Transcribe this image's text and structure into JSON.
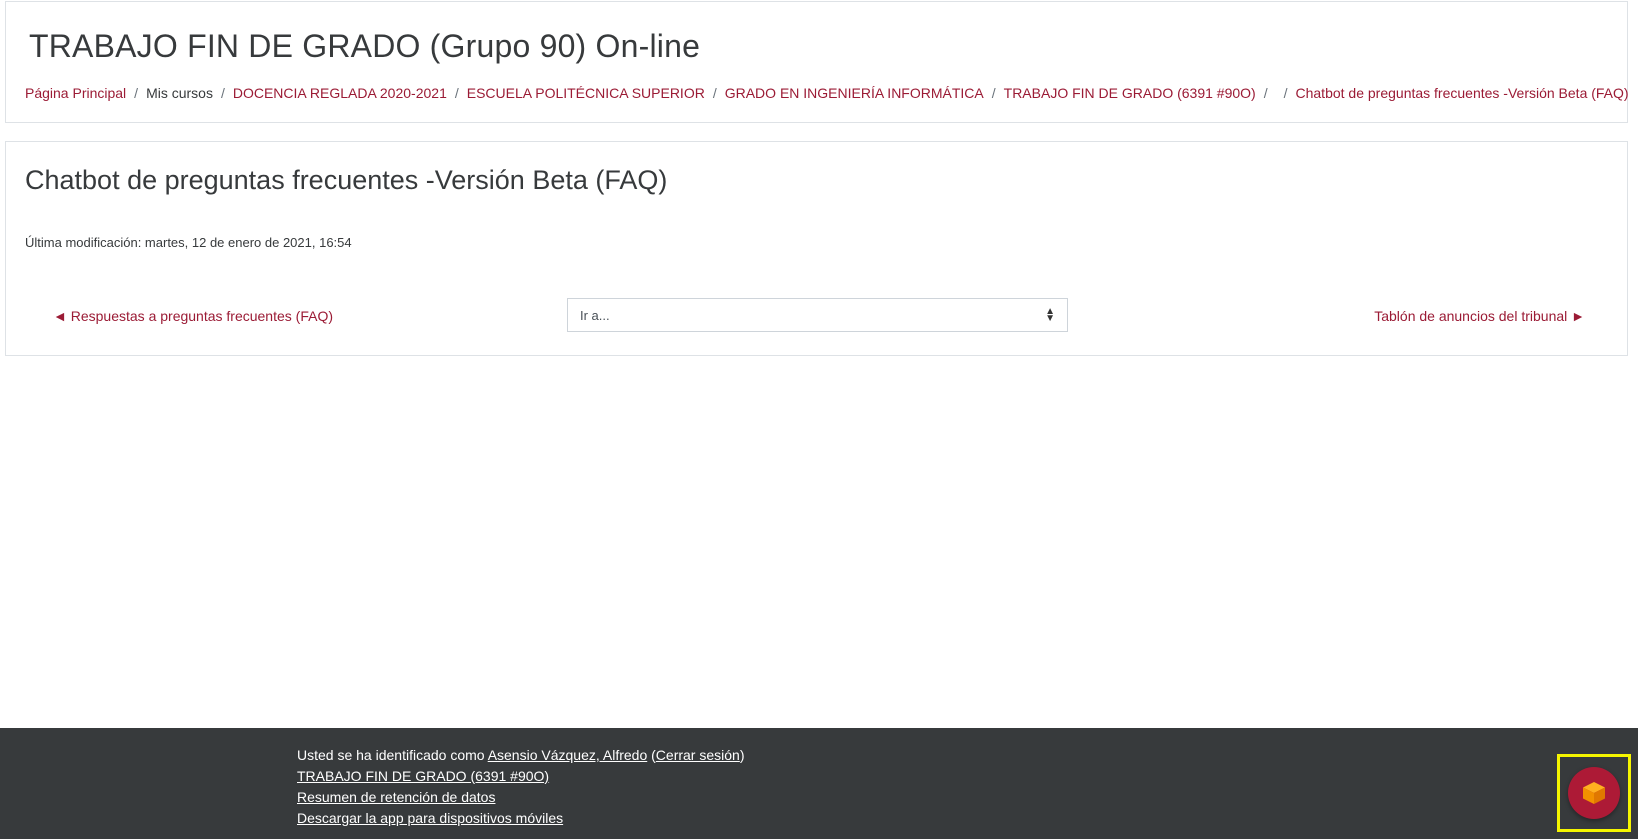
{
  "header": {
    "course_title": "TRABAJO FIN DE GRADO (Grupo 90) On-line",
    "breadcrumb": [
      {
        "label": "Página Principal",
        "link": true
      },
      {
        "label": "Mis cursos",
        "link": false
      },
      {
        "label": "DOCENCIA REGLADA 2020-2021",
        "link": true
      },
      {
        "label": "ESCUELA POLITÉCNICA SUPERIOR",
        "link": true
      },
      {
        "label": "GRADO EN INGENIERÍA INFORMÁTICA",
        "link": true
      },
      {
        "label": "TRABAJO FIN DE GRADO (6391 #90O)",
        "link": true
      },
      {
        "label": "",
        "link": false
      },
      {
        "label": "Chatbot de preguntas frecuentes -Versión Beta (FAQ)",
        "link": true
      }
    ]
  },
  "main": {
    "page_title": "Chatbot de preguntas frecuentes -Versión Beta (FAQ)",
    "last_modified": "Última modificación: martes, 12 de enero de 2021, 16:54",
    "prev_activity": "◄ Respuestas a preguntas frecuentes (FAQ)",
    "jump_to_placeholder": "Ir a...",
    "next_activity": "Tablón de anuncios del tribunal ►"
  },
  "footer": {
    "logged_in_prefix": "Usted se ha identificado como",
    "user_name": "Asensio Vázquez, Alfredo",
    "logout_open": " (",
    "logout_label": "Cerrar sesión",
    "logout_close": ")",
    "course_link": "TRABAJO FIN DE GRADO (6391 #90O)",
    "data_retention": "Resumen de retención de datos",
    "mobile_app": "Descargar la app para dispositivos móviles"
  },
  "chatbot": {
    "icon": "cube-icon",
    "button_color": "#ad1a36",
    "highlight_color": "#f5f500"
  },
  "colors": {
    "link": "#9b1b35",
    "footer_bg": "#373a3c"
  }
}
